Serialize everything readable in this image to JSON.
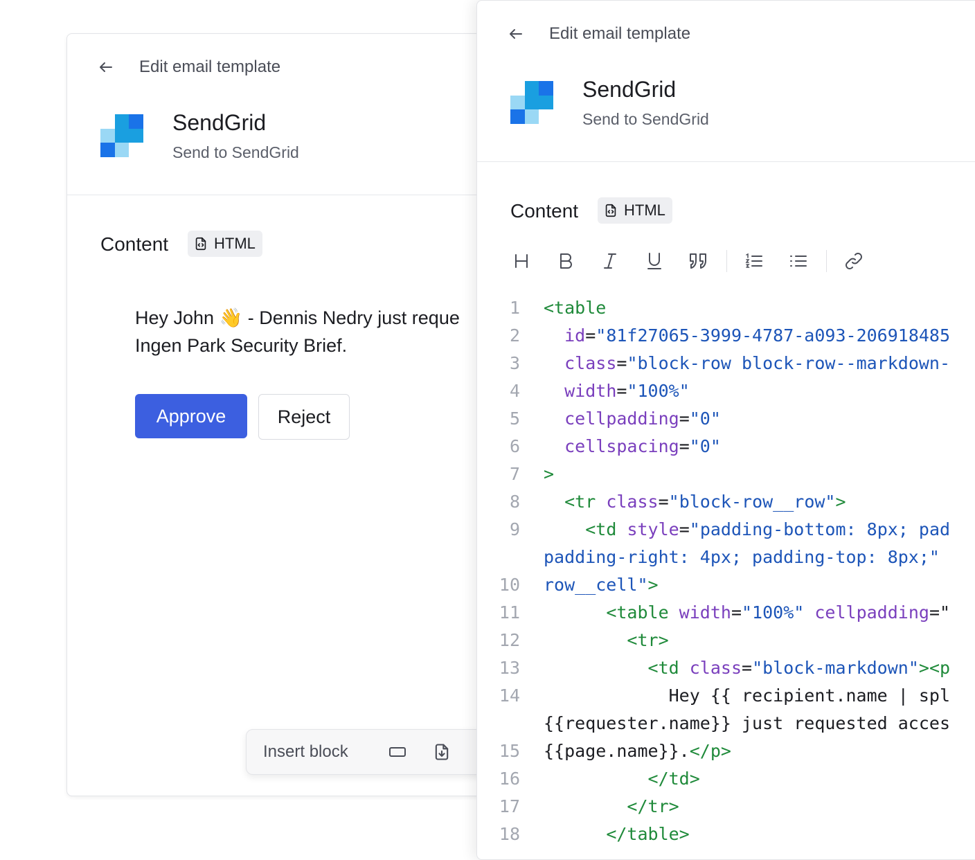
{
  "colors": {
    "accent": "#3c5fe0",
    "logo_dark": "#1a73e8",
    "logo_mid": "#1a9fe0",
    "logo_light": "#9ad8f5",
    "code_tag": "#1f8a3a",
    "code_attr": "#7a3fbd",
    "code_string": "#1d55b8"
  },
  "preview_panel": {
    "header": {
      "back_icon": "arrow-left-icon",
      "title": "Edit email template"
    },
    "integration": {
      "name": "SendGrid",
      "subtitle": "Send to SendGrid"
    },
    "content_label": "Content",
    "format_badge": "HTML",
    "message_line1_pre": "Hey John",
    "message_emoji": "👋",
    "message_line1_post": " - Dennis Nedry just reque",
    "message_line2": "Ingen Park Security Brief.",
    "approve_label": "Approve",
    "reject_label": "Reject",
    "insert_block_label": "Insert block",
    "insert_icons": [
      "button-block-icon",
      "file-download-icon"
    ]
  },
  "editor_panel": {
    "header": {
      "back_icon": "arrow-left-icon",
      "title": "Edit email template"
    },
    "integration": {
      "name": "SendGrid",
      "subtitle": "Send to SendGrid"
    },
    "content_label": "Content",
    "format_badge": "HTML",
    "toolbar": [
      "heading-icon",
      "bold-icon",
      "italic-icon",
      "underline-icon",
      "quote-icon",
      "ordered-list-icon",
      "bullet-list-icon",
      "link-icon"
    ],
    "code_lines": [
      {
        "n": "1",
        "indent": "",
        "parts": [
          [
            "tg",
            "<table"
          ]
        ]
      },
      {
        "n": "2",
        "indent": "  ",
        "parts": [
          [
            "at",
            "id"
          ],
          [
            "tx",
            "="
          ],
          [
            "st",
            "\"81f27065-3999-4787-a093-206918485"
          ]
        ]
      },
      {
        "n": "3",
        "indent": "  ",
        "parts": [
          [
            "at",
            "class"
          ],
          [
            "tx",
            "="
          ],
          [
            "st",
            "\"block-row block-row--markdown-"
          ]
        ]
      },
      {
        "n": "4",
        "indent": "  ",
        "parts": [
          [
            "at",
            "width"
          ],
          [
            "tx",
            "="
          ],
          [
            "st",
            "\"100%\""
          ]
        ]
      },
      {
        "n": "5",
        "indent": "  ",
        "parts": [
          [
            "at",
            "cellpadding"
          ],
          [
            "tx",
            "="
          ],
          [
            "st",
            "\"0\""
          ]
        ]
      },
      {
        "n": "6",
        "indent": "  ",
        "parts": [
          [
            "at",
            "cellspacing"
          ],
          [
            "tx",
            "="
          ],
          [
            "st",
            "\"0\""
          ]
        ]
      },
      {
        "n": "7",
        "indent": "",
        "parts": [
          [
            "tg",
            ">"
          ]
        ]
      },
      {
        "n": "8",
        "indent": "  ",
        "parts": [
          [
            "tg",
            "<tr "
          ],
          [
            "at",
            "class"
          ],
          [
            "tx",
            "="
          ],
          [
            "st",
            "\"block-row__row\""
          ],
          [
            "tg",
            ">"
          ]
        ]
      },
      {
        "n": "9",
        "indent": "    ",
        "parts": [
          [
            "tg",
            "<td "
          ],
          [
            "at",
            "style"
          ],
          [
            "tx",
            "="
          ],
          [
            "st",
            "\"padding-bottom: 8px; pad"
          ]
        ]
      },
      {
        "n": "",
        "indent": "",
        "parts": [
          [
            "st",
            "padding-right: 4px; padding-top: 8px;\""
          ]
        ]
      },
      {
        "n": "10",
        "indent": "",
        "parts": [
          [
            "st",
            "row__cell\""
          ],
          [
            "tg",
            ">"
          ]
        ]
      },
      {
        "n": "11",
        "indent": "      ",
        "parts": [
          [
            "tg",
            "<table "
          ],
          [
            "at",
            "width"
          ],
          [
            "tx",
            "="
          ],
          [
            "st",
            "\"100%\""
          ],
          [
            "tx",
            " "
          ],
          [
            "at",
            "cellpadding"
          ],
          [
            "tx",
            "=\""
          ]
        ]
      },
      {
        "n": "12",
        "indent": "        ",
        "parts": [
          [
            "tg",
            "<tr>"
          ]
        ]
      },
      {
        "n": "13",
        "indent": "          ",
        "parts": [
          [
            "tg",
            "<td "
          ],
          [
            "at",
            "class"
          ],
          [
            "tx",
            "="
          ],
          [
            "st",
            "\"block-markdown\""
          ],
          [
            "tg",
            "><p"
          ]
        ]
      },
      {
        "n": "14",
        "indent": "            ",
        "parts": [
          [
            "tx",
            "Hey {{ recipient.name | spl"
          ]
        ]
      },
      {
        "n": "",
        "indent": "",
        "parts": [
          [
            "tx",
            "{{requester.name}} just requested acces"
          ]
        ]
      },
      {
        "n": "15",
        "indent": "",
        "parts": [
          [
            "tx",
            "{{page.name}}."
          ],
          [
            "tg",
            "</p>"
          ]
        ]
      },
      {
        "n": "16",
        "indent": "          ",
        "parts": [
          [
            "tg",
            "</td>"
          ]
        ]
      },
      {
        "n": "17",
        "indent": "        ",
        "parts": [
          [
            "tg",
            "</tr>"
          ]
        ]
      },
      {
        "n": "18",
        "indent": "      ",
        "parts": [
          [
            "tg",
            "</table>"
          ]
        ]
      }
    ]
  }
}
